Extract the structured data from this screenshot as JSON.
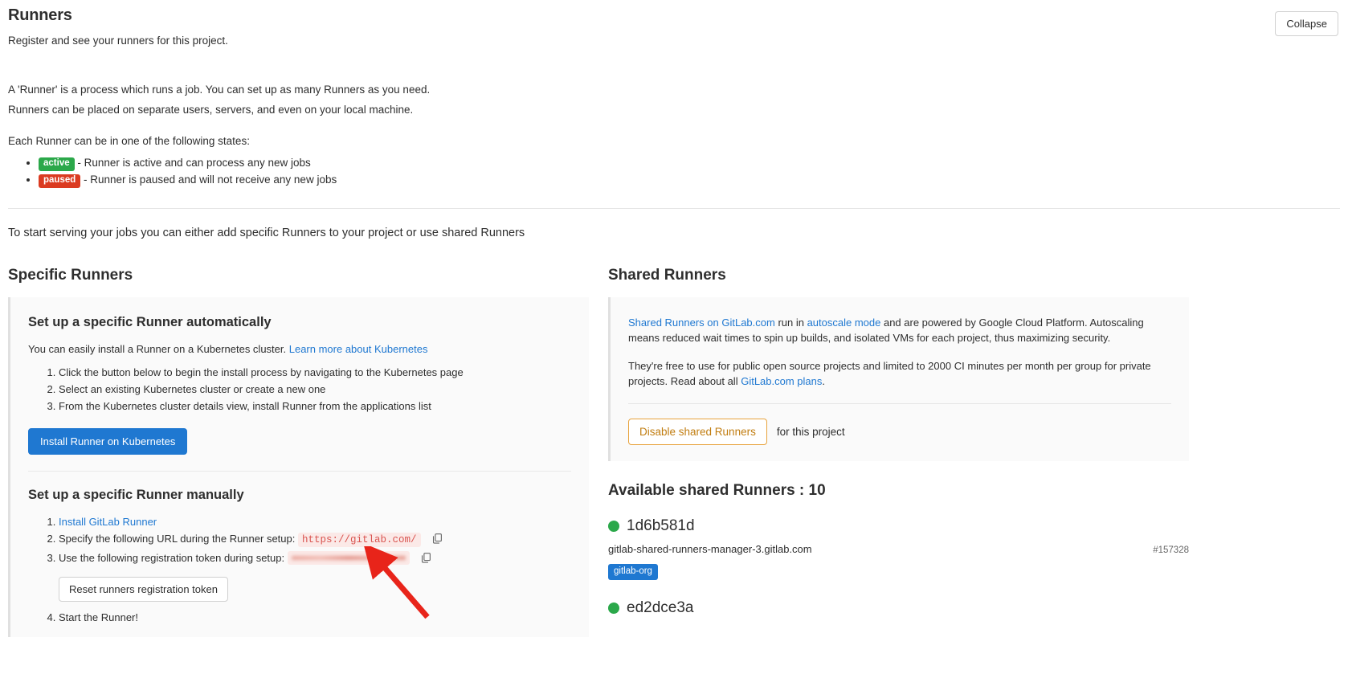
{
  "header": {
    "title": "Runners",
    "subtitle": "Register and see your runners for this project.",
    "collapse_label": "Collapse"
  },
  "intro": {
    "line1": "A 'Runner' is a process which runs a job. You can set up as many Runners as you need.",
    "line2": "Runners can be placed on separate users, servers, and even on your local machine.",
    "states_intro": "Each Runner can be in one of the following states:",
    "states": [
      {
        "badge": "active",
        "color": "#2ba84a",
        "text": "- Runner is active and can process any new jobs"
      },
      {
        "badge": "paused",
        "color": "#db3b21",
        "text": "- Runner is paused and will not receive any new jobs"
      }
    ],
    "serving_text": "To start serving your jobs you can either add specific Runners to your project or use shared Runners"
  },
  "specific_runners": {
    "section_title": "Specific Runners",
    "auto": {
      "heading": "Set up a specific Runner automatically",
      "intro_text": "You can easily install a Runner on a Kubernetes cluster.",
      "intro_link": "Learn more about Kubernetes",
      "steps": [
        "Click the button below to begin the install process by navigating to the Kubernetes page",
        "Select an existing Kubernetes cluster or create a new one",
        "From the Kubernetes cluster details view, install Runner from the applications list"
      ],
      "install_button": "Install Runner on Kubernetes"
    },
    "manual": {
      "heading": "Set up a specific Runner manually",
      "step1_link": "Install GitLab Runner",
      "step2_text": "Specify the following URL during the Runner setup:",
      "step2_value": "https://gitlab.com/",
      "step3_text": "Use the following registration token during setup:",
      "step3_value": "",
      "reset_button": "Reset runners registration token",
      "step4_text": "Start the Runner!"
    }
  },
  "shared_runners": {
    "section_title": "Shared Runners",
    "para1_link1": "Shared Runners on GitLab.com",
    "para1_mid": " run in ",
    "para1_link2": "autoscale mode",
    "para1_rest": " and are powered by Google Cloud Platform. Autoscaling means reduced wait times to spin up builds, and isolated VMs for each project, thus maximizing security.",
    "para2_text": "They're free to use for public open source projects and limited to 2000 CI minutes per month per group for private projects. Read about all ",
    "para2_link": "GitLab.com plans",
    "para2_end": ".",
    "disable_button": "Disable shared Runners",
    "disable_suffix": "for this project",
    "available_title": "Available shared Runners : 10",
    "runners": [
      {
        "name": "1d6b581d",
        "status_color": "#2ba84a",
        "host": "gitlab-shared-runners-manager-3.gitlab.com",
        "id": "#157328",
        "tag": "gitlab-org"
      },
      {
        "name": "ed2dce3a",
        "status_color": "#2ba84a",
        "host": "",
        "id": "",
        "tag": ""
      }
    ]
  },
  "annotation": {
    "arrow_color": "#e8241a"
  }
}
